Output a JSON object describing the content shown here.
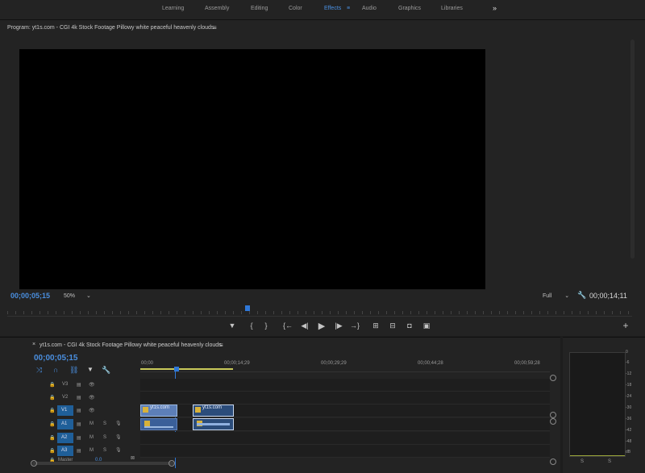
{
  "workspace_tabs": [
    "Learning",
    "Assembly",
    "Editing",
    "Color",
    "Effects",
    "Audio",
    "Graphics",
    "Libraries"
  ],
  "active_tab_index": 4,
  "more_label": "»",
  "program": {
    "title": "Program: yt1s.com - CGI 4k Stock Footage Pillowy white peaceful heavenly clouds",
    "menu_icon": "≡",
    "current_time": "00;00;05;15",
    "zoom": "50%",
    "quality": "Full",
    "duration": "00;00;14;11"
  },
  "transport": {
    "marker": "▼",
    "in": "{",
    "out": "}",
    "go_in": "{←",
    "step_back": "◀|",
    "play": "▶",
    "step_fwd": "|▶",
    "go_out": "→}",
    "lift": "⊞",
    "extract": "⊟",
    "export_frame": "◘",
    "compare": "▣",
    "add": "+"
  },
  "timeline": {
    "sequence_title": "yt1s.com - CGI 4k Stock Footage Pillowy white peaceful heavenly clouds",
    "close_label": "×",
    "menu_icon": "≡",
    "current_time": "00;00;05;15",
    "ruler_labels": [
      "00;00",
      "00;00;14;29",
      "00;00;29;29",
      "00;00;44;28",
      "00;00;59;28"
    ],
    "video_tracks": [
      {
        "lock": "🔒",
        "name": "V3",
        "eye": "👁"
      },
      {
        "lock": "🔒",
        "name": "V2",
        "eye": "👁"
      },
      {
        "lock": "🔒",
        "name": "V1",
        "eye": "👁",
        "source": "V1"
      }
    ],
    "audio_tracks": [
      {
        "lock": "🔒",
        "name": "A1",
        "source": "A1",
        "m": "M",
        "s": "S"
      },
      {
        "lock": "🔒",
        "name": "A2",
        "m": "M",
        "s": "S"
      },
      {
        "lock": "🔒",
        "name": "A3",
        "m": "M",
        "s": "S"
      }
    ],
    "master_label": "Master",
    "master_value": "0.0",
    "clips": {
      "v1_a": "yt1s.com",
      "v1_b": "yt1s.com",
      "fx": "fx"
    }
  },
  "meter": {
    "scale": [
      "0",
      "-6",
      "-12",
      "-18",
      "-24",
      "-30",
      "-36",
      "-42",
      "-48",
      "dB"
    ],
    "solo_left": "S",
    "solo_right": "S"
  }
}
